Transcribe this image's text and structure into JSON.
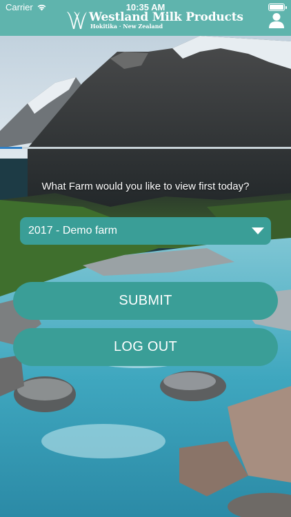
{
  "status_bar": {
    "carrier": "Carrier",
    "time": "10:35 AM"
  },
  "header": {
    "brand_name": "Westland Milk Products",
    "brand_sub": "Hokitika · New Zealand"
  },
  "progress": {
    "fraction": 0.075
  },
  "prompt": {
    "question": "What Farm would you like to view first today?"
  },
  "farm_select": {
    "selected": "2017 - Demo farm"
  },
  "buttons": {
    "submit": "SUBMIT",
    "logout": "LOG OUT"
  },
  "colors": {
    "header": "#5fb4ad",
    "accent": "#3a9e97",
    "progress": "#2f7fc4"
  },
  "icons": {
    "wifi": "wifi-icon",
    "battery": "battery-icon",
    "user": "user-icon",
    "caret": "caret-down-icon",
    "logo": "westland-logo-icon"
  }
}
